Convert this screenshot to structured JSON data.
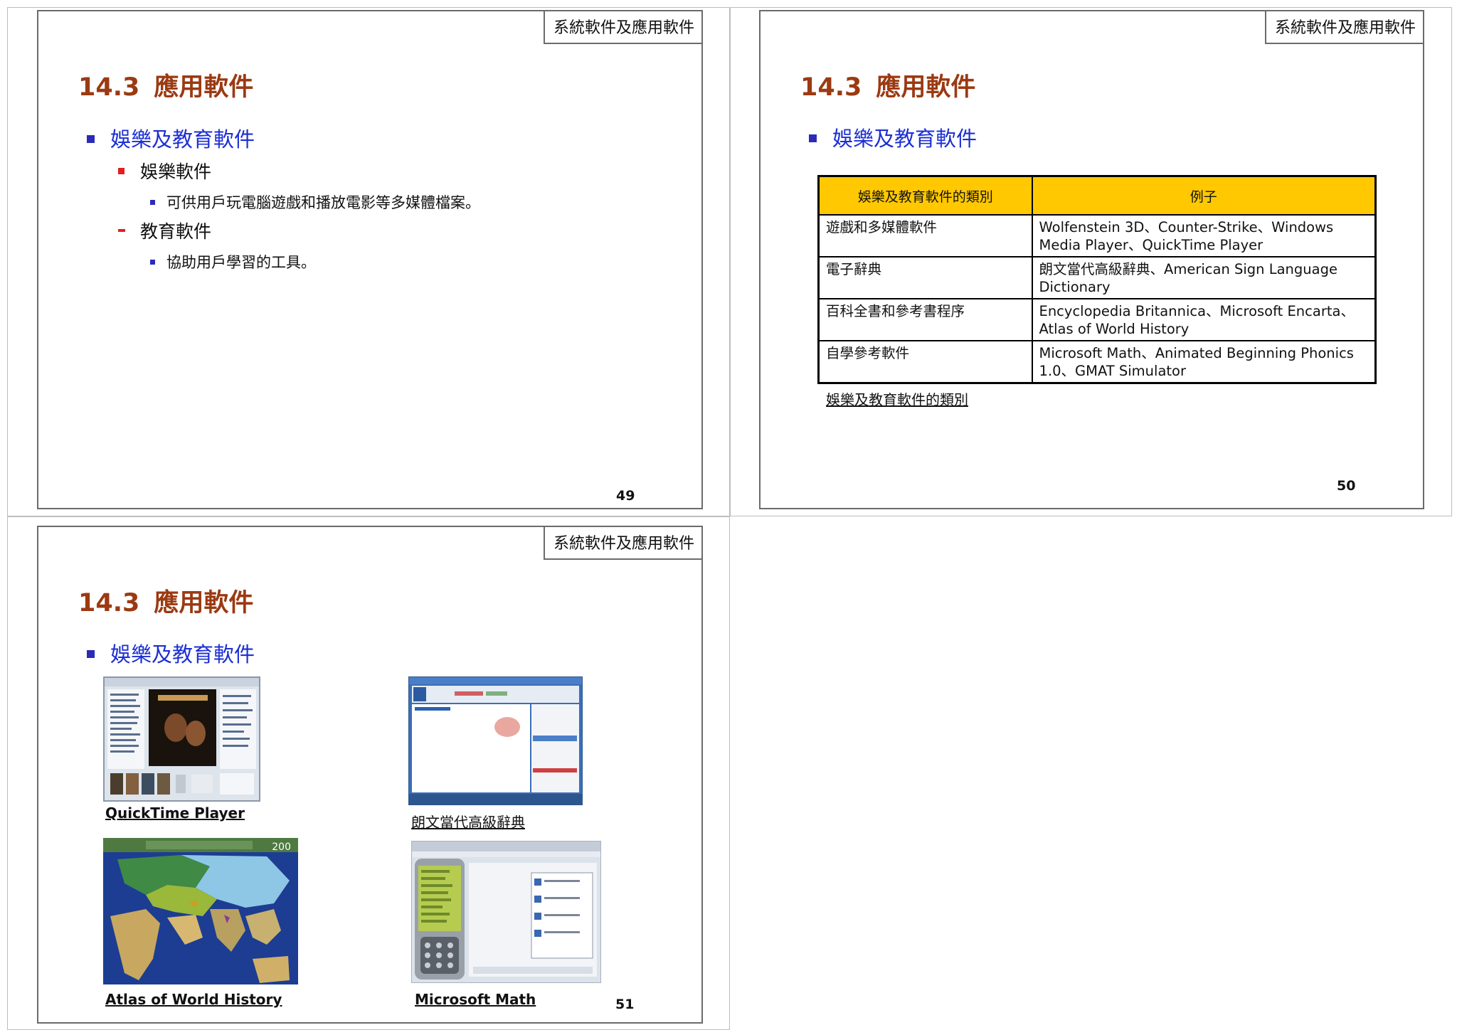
{
  "slides": [
    {
      "header": "系統軟件及應用軟件",
      "title_num": "14.3",
      "title_text": "應用軟件",
      "bullet": "娛樂及教育軟件",
      "sub1": "娛樂軟件",
      "sub1_detail": "可供用戶玩電腦遊戲和播放電影等多媒體檔案。",
      "sub2": "教育軟件",
      "sub2_detail": "協助用戶學習的工具。",
      "page": "49"
    },
    {
      "header": "系統軟件及應用軟件",
      "title_num": "14.3",
      "title_text": "應用軟件",
      "bullet": "娛樂及教育軟件",
      "table": {
        "headers": [
          "娛樂及教育軟件的類別",
          "例子"
        ],
        "rows": [
          [
            "遊戲和多媒體軟件",
            "Wolfenstein 3D、Counter-Strike、Windows Media Player、QuickTime Player"
          ],
          [
            "電子辭典",
            "朗文當代高級辭典、American Sign Language Dictionary"
          ],
          [
            "百科全書和參考書程序",
            "Encyclopedia Britannica、Microsoft Encarta、Atlas of World History"
          ],
          [
            "自學參考軟件",
            "Microsoft Math、Animated Beginning Phonics 1.0、GMAT Simulator"
          ]
        ]
      },
      "table_caption": "娛樂及教育軟件的類別",
      "page": "50"
    },
    {
      "header": "系統軟件及應用軟件",
      "title_num": "14.3",
      "title_text": "應用軟件",
      "bullet": "娛樂及教育軟件",
      "images": [
        {
          "caption": "QuickTime Player"
        },
        {
          "caption": "朗文當代高級辭典"
        },
        {
          "caption": "Atlas of World History",
          "counter": "200"
        },
        {
          "caption": "Microsoft Math"
        }
      ],
      "page": "51"
    }
  ]
}
